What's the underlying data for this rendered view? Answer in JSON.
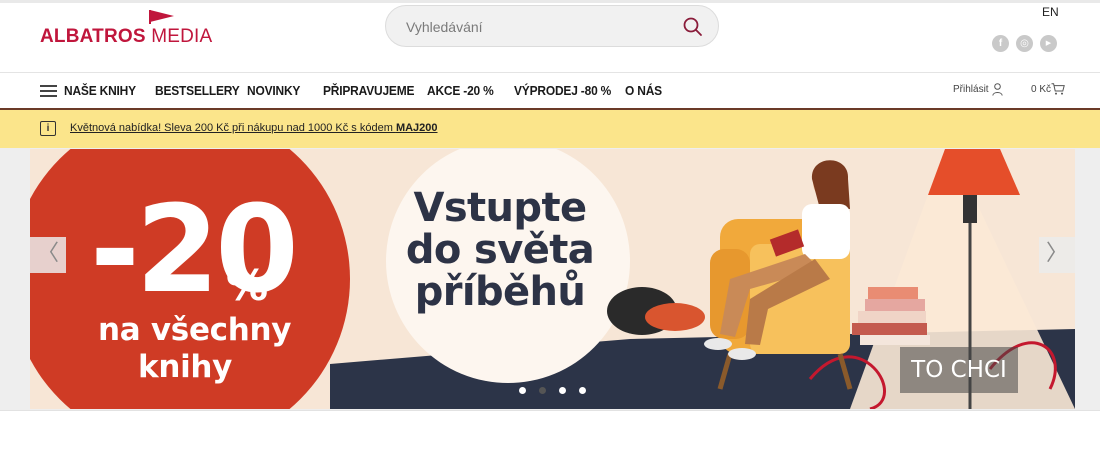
{
  "brand": {
    "logo_bold": "ALBATROS",
    "logo_light": "MEDIA",
    "color": "#c0163c"
  },
  "search": {
    "placeholder": "Vyhledávání",
    "icon": "search-icon"
  },
  "header": {
    "language": "EN",
    "social": [
      {
        "name": "facebook-icon",
        "glyph": "f"
      },
      {
        "name": "instagram-icon",
        "glyph": "◎"
      },
      {
        "name": "youtube-icon",
        "glyph": "▶"
      }
    ]
  },
  "nav": {
    "menu_icon": "hamburger-icon",
    "items": [
      {
        "label": "NAŠE KNIHY"
      },
      {
        "label": "BESTSELLERY"
      },
      {
        "label": "NOVINKY"
      },
      {
        "label": "PŘIPRAVUJEME"
      },
      {
        "label": "AKCE -20 %"
      },
      {
        "label": "VÝPRODEJ -80 %"
      },
      {
        "label": "O NÁS"
      }
    ],
    "login_label": "Přihlásit",
    "cart_total": "0 Kč",
    "border_color": "#6b3a28"
  },
  "promo": {
    "text": "Květnová nabídka! Sleva 200 Kč při nákupu nad 1000 Kč s kódem ",
    "code": "MAJ200",
    "background": "#fbe58b",
    "icon": "info-icon"
  },
  "banner": {
    "discount": "-20",
    "percent": "%",
    "sub_line1": "na všechny",
    "sub_line2": "knihy",
    "headline_line1": "Vstupte",
    "headline_line2": "do světa",
    "headline_line3": "příběhů",
    "cta_label": "TO CHCI",
    "prev_glyph": "〈",
    "next_glyph": "〉",
    "slides_count": 4,
    "active_slide": 2,
    "accent_color": "#cf3b25"
  }
}
